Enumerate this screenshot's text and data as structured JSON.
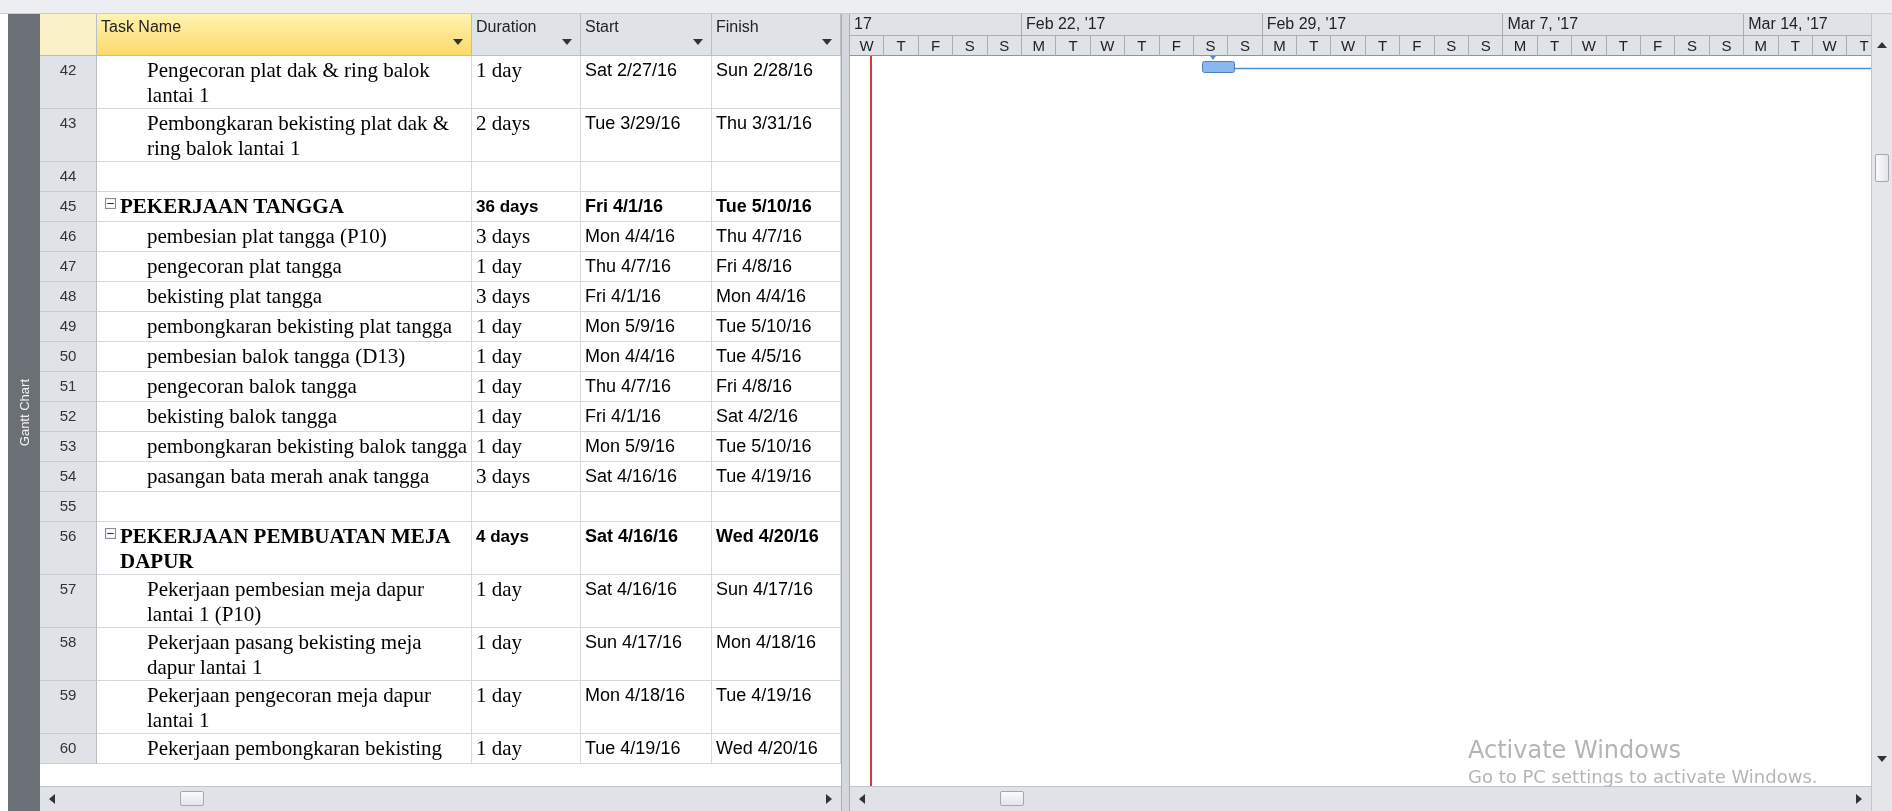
{
  "side_tab": {
    "label": "Gantt Chart"
  },
  "table": {
    "columns": [
      {
        "label": "Task Name",
        "selected": true
      },
      {
        "label": "Duration",
        "selected": false
      },
      {
        "label": "Start",
        "selected": false
      },
      {
        "label": "Finish",
        "selected": false
      }
    ],
    "rows": [
      {
        "id": "42",
        "kind": "task",
        "name": "Pengecoran plat dak & ring balok lantai 1",
        "duration": "1 day",
        "start": "Sat 2/27/16",
        "finish": "Sun 2/28/16"
      },
      {
        "id": "43",
        "kind": "task",
        "name": "Pembongkaran bekisting plat dak & ring balok lantai 1",
        "duration": "2 days",
        "start": "Tue 3/29/16",
        "finish": "Thu 3/31/16"
      },
      {
        "id": "44",
        "kind": "blank"
      },
      {
        "id": "45",
        "kind": "summary",
        "expanded": true,
        "name": "PEKERJAAN TANGGA",
        "duration": "36 days",
        "start": "Fri 4/1/16",
        "finish": "Tue 5/10/16"
      },
      {
        "id": "46",
        "kind": "task",
        "name": "pembesian plat tangga (P10)",
        "duration": "3 days",
        "start": "Mon 4/4/16",
        "finish": "Thu 4/7/16"
      },
      {
        "id": "47",
        "kind": "task",
        "name": "pengecoran plat tangga",
        "duration": "1 day",
        "start": "Thu 4/7/16",
        "finish": "Fri 4/8/16"
      },
      {
        "id": "48",
        "kind": "task",
        "name": "bekisting plat tangga",
        "duration": "3 days",
        "start": "Fri 4/1/16",
        "finish": "Mon 4/4/16"
      },
      {
        "id": "49",
        "kind": "task",
        "name": "pembongkaran bekisting plat tangga",
        "duration": "1 day",
        "start": "Mon 5/9/16",
        "finish": "Tue 5/10/16"
      },
      {
        "id": "50",
        "kind": "task",
        "name": "pembesian balok tangga (D13)",
        "duration": "1 day",
        "start": "Mon 4/4/16",
        "finish": "Tue 4/5/16"
      },
      {
        "id": "51",
        "kind": "task",
        "name": "pengecoran balok tangga",
        "duration": "1 day",
        "start": "Thu 4/7/16",
        "finish": "Fri 4/8/16"
      },
      {
        "id": "52",
        "kind": "task",
        "name": "bekisting balok tangga",
        "duration": "1 day",
        "start": "Fri 4/1/16",
        "finish": "Sat 4/2/16"
      },
      {
        "id": "53",
        "kind": "task",
        "name": "pembongkaran bekisting balok tangga",
        "duration": "1 day",
        "start": "Mon 5/9/16",
        "finish": "Tue 5/10/16"
      },
      {
        "id": "54",
        "kind": "task",
        "name": "pasangan bata merah anak tangga",
        "duration": "3 days",
        "start": "Sat 4/16/16",
        "finish": "Tue 4/19/16"
      },
      {
        "id": "55",
        "kind": "blank"
      },
      {
        "id": "56",
        "kind": "summary",
        "expanded": true,
        "name": "PEKERJAAN PEMBUATAN MEJA DAPUR",
        "duration": "4 days",
        "start": "Sat 4/16/16",
        "finish": "Wed 4/20/16"
      },
      {
        "id": "57",
        "kind": "task",
        "name": "Pekerjaan pembesian meja dapur lantai 1 (P10)",
        "duration": "1 day",
        "start": "Sat 4/16/16",
        "finish": "Sun 4/17/16"
      },
      {
        "id": "58",
        "kind": "task",
        "name": "Pekerjaan pasang bekisting meja dapur lantai 1",
        "duration": "1 day",
        "start": "Sun 4/17/16",
        "finish": "Mon 4/18/16"
      },
      {
        "id": "59",
        "kind": "task",
        "name": "Pekerjaan pengecoran meja dapur lantai 1",
        "duration": "1 day",
        "start": "Mon 4/18/16",
        "finish": "Tue 4/19/16"
      },
      {
        "id": "60",
        "kind": "task",
        "name": "Pekerjaan pembongkaran bekisting",
        "duration": "1 day",
        "start": "Tue 4/19/16",
        "finish": "Wed 4/20/16"
      }
    ]
  },
  "timescale": {
    "weeks": [
      {
        "label": "17",
        "days": [
          "W",
          "T",
          "F",
          "S",
          "S"
        ]
      },
      {
        "label": "Feb 22, '17",
        "days": [
          "M",
          "T",
          "W",
          "T",
          "F",
          "S",
          "S"
        ]
      },
      {
        "label": "Feb 29, '17",
        "days": [
          "M",
          "T",
          "W",
          "T",
          "F",
          "S",
          "S"
        ]
      },
      {
        "label": "Mar 7, '17",
        "days": [
          "M",
          "T",
          "W",
          "T",
          "F",
          "S",
          "S"
        ]
      },
      {
        "label": "Mar 14, '17",
        "days": [
          "M",
          "T",
          "W",
          "T"
        ]
      }
    ]
  },
  "os_notice": {
    "title": "Activate Windows",
    "text": "Go to PC settings to activate Windows."
  }
}
